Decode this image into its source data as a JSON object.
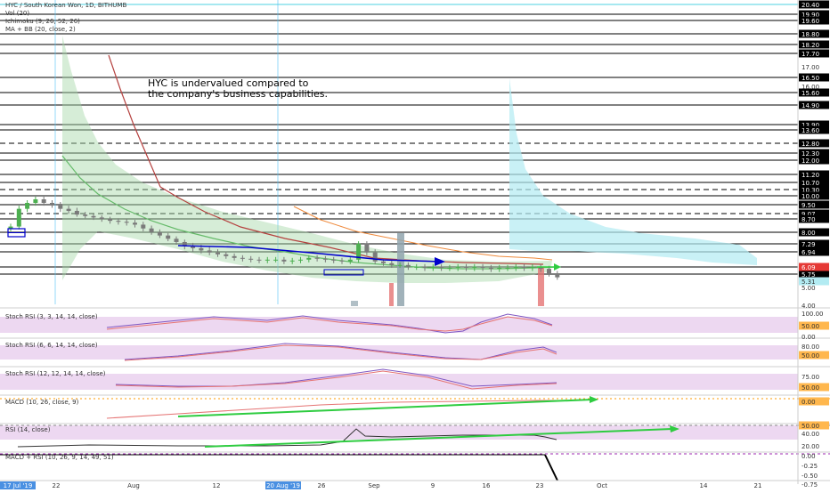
{
  "header": {
    "symbol_line": "HYC / South Korean Won, 1D, BITHUMB",
    "vol_line": "Vol (20)",
    "ichimoku_line": "Ichimoku (9, 26, 52, 26)",
    "mabb_line": "MA + BB (20, close, 2)"
  },
  "annotation": {
    "line1": "HYC is undervalued compared to",
    "line2": "the company's business capabilities."
  },
  "colors": {
    "price_axis_bg": "#ffffff",
    "label_box": "#000000",
    "up_candle": "#4caf50",
    "down_candle": "#7a7a7a",
    "cloud_green": "#a5d6a7",
    "cloud_cyan": "#b2ebf2",
    "stoch_band": "#e1bee7",
    "accent_red": "#e57373",
    "arrow_blue": "#0000cc",
    "arrow_green": "#2ecc40",
    "bb_line": "#66bb6a",
    "ichi_red": "#b5413f",
    "ichi_orange": "#ef8a3c"
  },
  "chart_data": [
    {
      "type": "line",
      "pane": "price",
      "title": "HYC / South Korean Won, 1D, BITHUMB",
      "x_ticks": [
        "17 Jul '19",
        "22",
        "Aug",
        "12",
        "20 Aug '19",
        "26",
        "Sep",
        "9",
        "16",
        "23",
        "Oct",
        "14",
        "21"
      ],
      "y_ticks": [
        20.4,
        19.9,
        19.6,
        18.8,
        18.2,
        17.7,
        17.0,
        16.5,
        16.0,
        15.6,
        14.9,
        13.9,
        13.6,
        12.8,
        12.3,
        12.0,
        11.2,
        10.7,
        10.3,
        10.0,
        9.5,
        9.07,
        8.7,
        8.0,
        7.29,
        6.94,
        6.09,
        5.75,
        5.31,
        5.0,
        4.0
      ],
      "boxed_levels": [
        20.4,
        19.9,
        19.6,
        18.8,
        18.2,
        17.7,
        16.5,
        15.6,
        14.9,
        13.9,
        13.6,
        12.8,
        12.3,
        12.0,
        11.2,
        10.7,
        10.3,
        10.0,
        9.5,
        9.07,
        8.7,
        8.0,
        7.29,
        6.94,
        6.09,
        5.75
      ],
      "dashed_levels": [
        12.8,
        10.3,
        9.07
      ],
      "close": [
        8.3,
        9.3,
        9.6,
        9.8,
        9.6,
        9.5,
        9.3,
        9.2,
        9.0,
        8.9,
        8.8,
        8.7,
        8.6,
        8.55,
        8.5,
        8.4,
        8.2,
        8.0,
        7.8,
        7.6,
        7.4,
        7.2,
        7.1,
        7.0,
        6.9,
        6.8,
        6.7,
        6.6,
        6.55,
        6.5,
        6.45,
        6.5,
        6.5,
        6.4,
        6.45,
        6.5,
        6.6,
        6.55,
        6.5,
        6.45,
        6.4,
        6.5,
        7.3,
        6.9,
        6.4,
        6.3,
        6.2,
        6.2,
        6.1,
        6.1,
        6.05,
        6.1,
        6.05,
        6.05,
        6.1,
        6.05,
        6.1,
        6.05,
        6.0,
        6.05,
        6.05,
        6.1,
        6.05,
        6.1,
        6.0,
        5.75,
        5.55
      ]
    },
    {
      "type": "line",
      "pane": "stoch_rsi_1",
      "title": "Stoch RSI (3, 3, 14, 14, close)",
      "y_ticks": [
        100.0,
        50.0,
        0.0
      ],
      "level_label": "50.00"
    },
    {
      "type": "line",
      "pane": "stoch_rsi_2",
      "title": "Stoch RSI (6, 6, 14, 14, close)",
      "y_ticks": [
        80.0,
        50.0
      ],
      "level_label": "50.00"
    },
    {
      "type": "line",
      "pane": "stoch_rsi_3",
      "title": "Stoch RSI (12, 12, 14, 14, close)",
      "y_ticks": [
        75.0,
        50.0
      ],
      "level_label": "50.00"
    },
    {
      "type": "line",
      "pane": "macd",
      "title": "MACD (10, 26, close, 9)",
      "y_ticks": [
        0.0
      ],
      "level_label": "0.00"
    },
    {
      "type": "line",
      "pane": "rsi",
      "title": "RSI (14, close)",
      "y_ticks": [
        50.0,
        40.0,
        20.0
      ],
      "level_label": "50.00"
    },
    {
      "type": "line",
      "pane": "macd_rsi",
      "title": "MACD + RSI (10, 26, 9, 14, 49, 51)",
      "y_ticks": [
        0.0,
        -0.25,
        -0.5,
        -0.75,
        -1.0
      ]
    }
  ]
}
